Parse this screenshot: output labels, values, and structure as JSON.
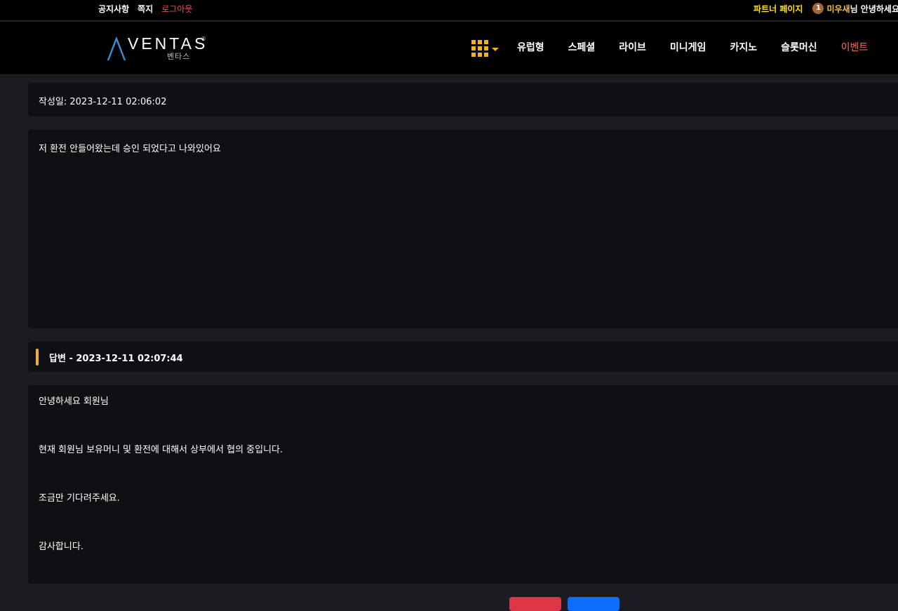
{
  "topbar": {
    "notice": "공지사항",
    "message": "쪽지",
    "logout": "로그아웃",
    "partner": "파트너 페이지",
    "level": "1",
    "nickname": "미우새",
    "greeting": "님 안녕하세요"
  },
  "header": {
    "logo_text": "VENTAS",
    "logo_sub": "벤타스",
    "logo_reg": "®",
    "menu_icon": "grid-icon",
    "nav": [
      {
        "label": "유럽형"
      },
      {
        "label": "스페셜"
      },
      {
        "label": "라이브"
      },
      {
        "label": "미니게임"
      },
      {
        "label": "카지노"
      },
      {
        "label": "슬롯머신"
      },
      {
        "label": "이벤트"
      }
    ]
  },
  "post": {
    "date_label": "작성일: 2023-12-11 02:06:02",
    "question": "저 환전 안들어왔는데 승인 되었다고 나와있어요"
  },
  "answer": {
    "title": "답변 - 2023-12-11 02:07:44",
    "lines": [
      "안녕하세요 회원님",
      "현재 회원님 보유머니 및 환전에 대해서 상부에서 협의 중입니다.",
      "조금만 기다려주세요.",
      "감사합니다."
    ]
  },
  "colors": {
    "accent": "#f2b02a",
    "partner": "#ffe11a",
    "logout": "#e0584f",
    "event": "#ff6a4d",
    "delete_button": "#dc3545",
    "list_button": "#0d6efd"
  }
}
